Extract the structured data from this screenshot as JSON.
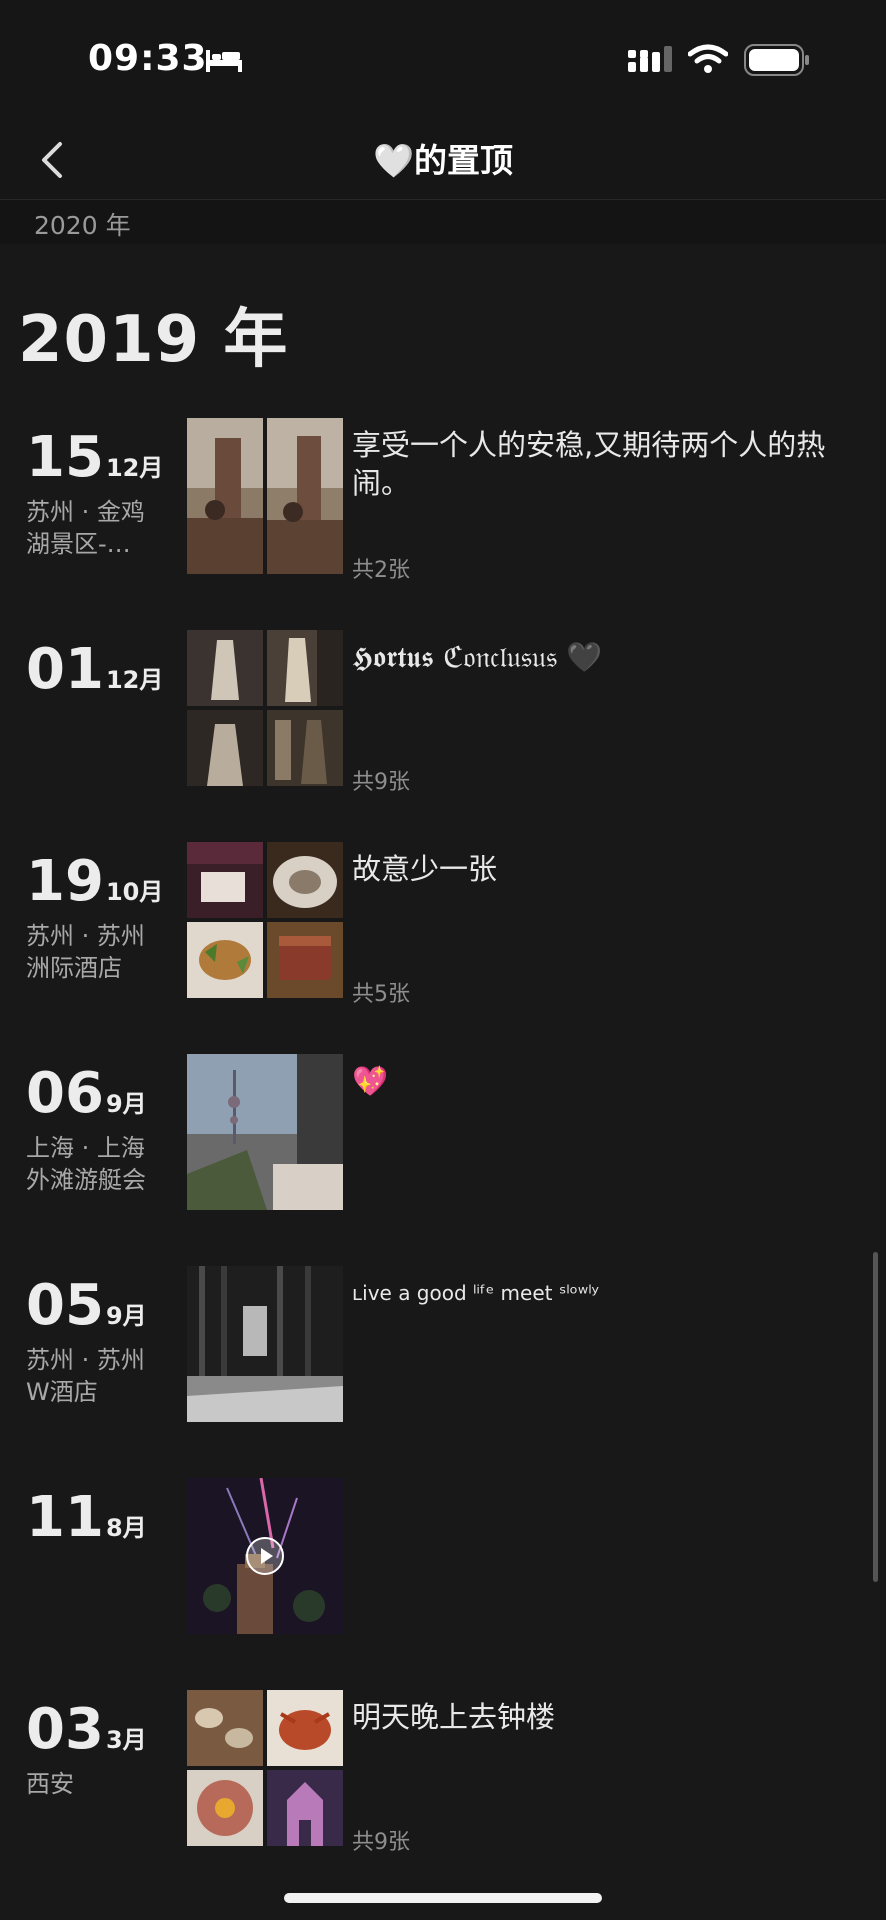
{
  "status_bar": {
    "time": "09:33"
  },
  "nav": {
    "title": "🤍的置顶"
  },
  "sticky_year": "2020 年",
  "year_heading": "2019 年",
  "entries": [
    {
      "day": "15",
      "month": "12月",
      "location": "苏州 · 金鸡湖景区-…",
      "caption": "享受一个人的安稳,又期待两个人的热闹。",
      "count": "共2张",
      "thumb_colors": [
        "#6b5a48",
        "#7a6650"
      ]
    },
    {
      "day": "01",
      "month": "12月",
      "location": "",
      "caption": "𝕳𝖔𝖗𝖙𝖚𝖘 ℭ𝔬𝔫𝔠𝔩𝔲𝔰𝔲𝔰 🖤",
      "count": "共9张",
      "thumb_colors": [
        "#3a3330",
        "#4a4038",
        "#2e2824",
        "#3d342c"
      ]
    },
    {
      "day": "19",
      "month": "10月",
      "location": "苏州 · 苏州洲际酒店",
      "caption": "故意少一张",
      "count": "共5张",
      "thumb_colors": [
        "#3a1e28",
        "#6a5a4c",
        "#8a6a3a",
        "#6a3a2a"
      ]
    },
    {
      "day": "06",
      "month": "9月",
      "location": "上海 · 上海外滩游艇会",
      "caption": "💖",
      "count": "",
      "thumb_colors": [
        "#6b7d8e"
      ]
    },
    {
      "day": "05",
      "month": "9月",
      "location": "苏州 · 苏州W酒店",
      "caption": "ʟive a good ˡⁱᶠᵉ meet ˢˡᵒʷˡʸ",
      "count": "",
      "thumb_colors": [
        "#2a2a2a"
      ]
    },
    {
      "day": "11",
      "month": "8月",
      "location": "",
      "caption": "",
      "count": "",
      "thumb_colors": [
        "#1a1424"
      ]
    },
    {
      "day": "03",
      "month": "3月",
      "location": "西安",
      "caption": "明天晚上去钟楼",
      "count": "共9张",
      "thumb_colors": [
        "#7a5a40",
        "#8a3a2a",
        "#8a6a5a",
        "#5a2a40"
      ]
    }
  ]
}
